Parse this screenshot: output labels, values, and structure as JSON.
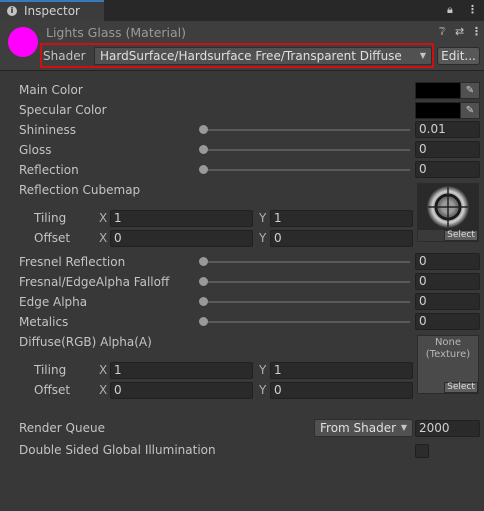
{
  "window": {
    "tab_label": "Inspector",
    "tab_icon": "info-icon",
    "lock_icon": "lock-icon",
    "menu_icon": "kebab-menu-icon"
  },
  "header": {
    "title": "Lights Glass (Material)",
    "material_color": "#ff00ff",
    "shader_label": "Shader",
    "shader_value": "HardSurface/Hardsurface Free/Transparent Diffuse",
    "edit_button": "Edit...",
    "help_icon": "help-icon",
    "preset_icon": "preset-sliders-icon",
    "menu_icon": "kebab-menu-icon"
  },
  "properties": {
    "main_color": {
      "label": "Main Color",
      "value": "#000000"
    },
    "specular_color": {
      "label": "Specular Color",
      "value": "#000000"
    },
    "shininess": {
      "label": "Shininess",
      "value": "0.01",
      "fraction": 0.01
    },
    "gloss": {
      "label": "Gloss",
      "value": "0",
      "fraction": 0
    },
    "reflection": {
      "label": "Reflection",
      "value": "0",
      "fraction": 0
    },
    "reflection_cubemap": {
      "label": "Reflection Cubemap",
      "select": "Select",
      "tiling_label": "Tiling",
      "offset_label": "Offset",
      "x_label": "X",
      "y_label": "Y",
      "tiling_x": "1",
      "tiling_y": "1",
      "offset_x": "0",
      "offset_y": "0"
    },
    "fresnel_reflection": {
      "label": "Fresnel Reflection",
      "value": "0",
      "fraction": 0
    },
    "fresnel_falloff": {
      "label": "Fresnal/EdgeAlpha Falloff",
      "value": "0",
      "fraction": 0
    },
    "edge_alpha": {
      "label": "Edge Alpha",
      "value": "0",
      "fraction": 0
    },
    "metalics": {
      "label": "Metalics",
      "value": "0",
      "fraction": 0
    },
    "diffuse": {
      "label": "Diffuse(RGB) Alpha(A)",
      "none_line1": "None",
      "none_line2": "(Texture)",
      "select": "Select",
      "tiling_label": "Tiling",
      "offset_label": "Offset",
      "x_label": "X",
      "y_label": "Y",
      "tiling_x": "1",
      "tiling_y": "1",
      "offset_x": "0",
      "offset_y": "0"
    },
    "render_queue": {
      "label": "Render Queue",
      "mode": "From Shader",
      "value": "2000"
    },
    "double_sided_gi": {
      "label": "Double Sided Global Illumination",
      "checked": false
    }
  }
}
